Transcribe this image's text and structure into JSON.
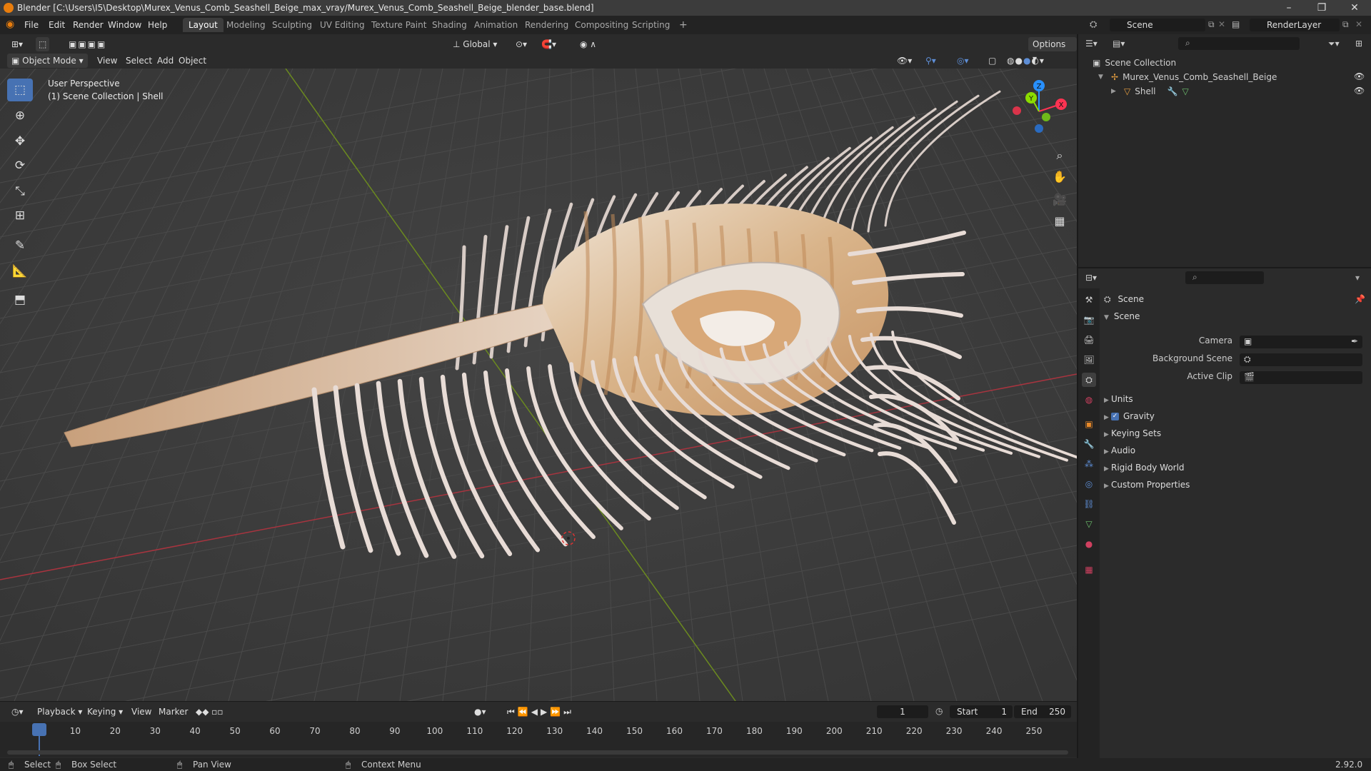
{
  "window": {
    "title": "Blender [C:\\Users\\I5\\Desktop\\Murex_Venus_Comb_Seashell_Beige_max_vray/Murex_Venus_Comb_Seashell_Beige_blender_base.blend]",
    "minimize": "–",
    "maximize": "❐",
    "close": "✕"
  },
  "menu": {
    "items": [
      "File",
      "Edit",
      "Render",
      "Window",
      "Help"
    ]
  },
  "workspaces": {
    "tabs": [
      "Layout",
      "Modeling",
      "Sculpting",
      "UV Editing",
      "Texture Paint",
      "Shading",
      "Animation",
      "Rendering",
      "Compositing",
      "Scripting"
    ],
    "add": "+"
  },
  "scene_selector": {
    "value": "Scene"
  },
  "layer_selector": {
    "value": "RenderLayer"
  },
  "viewport_header": {
    "mode": "Object Mode",
    "menus": [
      "View",
      "Select",
      "Add",
      "Object"
    ],
    "orientation": "Global",
    "options": "Options"
  },
  "viewport": {
    "perspective": "User Perspective",
    "collection_info": "(1) Scene Collection | Shell",
    "gizmo": {
      "z": "Z",
      "y": "Y",
      "x": "X"
    }
  },
  "timeline": {
    "menus": [
      "Playback",
      "Keying",
      "View",
      "Marker"
    ],
    "current_frame": "1",
    "start_label": "Start",
    "start_value": "1",
    "end_label": "End",
    "end_value": "250",
    "ticks": [
      "1",
      "10",
      "20",
      "30",
      "40",
      "50",
      "60",
      "70",
      "80",
      "90",
      "100",
      "110",
      "120",
      "130",
      "140",
      "150",
      "160",
      "170",
      "180",
      "190",
      "200",
      "210",
      "220",
      "230",
      "240",
      "250"
    ]
  },
  "outliner": {
    "root": "Scene Collection",
    "items": [
      {
        "label": "Murex_Venus_Comb_Seashell_Beige"
      },
      {
        "label": "Shell"
      }
    ]
  },
  "properties": {
    "header": "Scene",
    "section": "Scene",
    "fields": [
      {
        "label": "Camera"
      },
      {
        "label": "Background Scene"
      },
      {
        "label": "Active Clip"
      }
    ],
    "panels": [
      "Units",
      "Gravity",
      "Keying Sets",
      "Audio",
      "Rigid Body World",
      "Custom Properties"
    ]
  },
  "statusbar": {
    "select": "Select",
    "box_select": "Box Select",
    "pan_view": "Pan View",
    "context_menu": "Context Menu",
    "version": "2.92.0"
  },
  "colors": {
    "accent": "#4772b3",
    "x_axis": "#ff3352",
    "y_axis": "#8bdc00",
    "z_axis": "#2890ff"
  }
}
